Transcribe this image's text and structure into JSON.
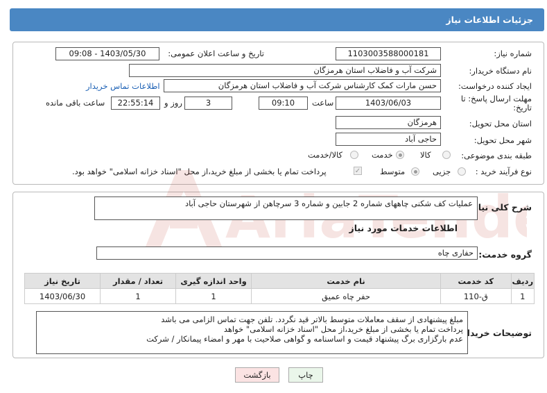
{
  "header": {
    "title": "جزئیات اطلاعات نیاز"
  },
  "form": {
    "need_number_label": "شماره نیاز:",
    "need_number": "1103003588000181",
    "announce_label": "تاریخ و ساعت اعلان عمومی:",
    "announce_value": "1403/05/30 - 09:08",
    "buyer_label": "نام دستگاه خریدار:",
    "buyer_value": "شرکت آب و فاضلاب استان هرمزگان",
    "creator_label": "ایجاد کننده درخواست:",
    "creator_value": "حسن مارات کمک کارشناس شرکت آب و فاضلاب استان هرمزگان",
    "contact_link": "اطلاعات تماس خریدار",
    "deadline_label": "مهلت ارسال پاسخ: تا تاریخ:",
    "deadline_date": "1403/06/03",
    "time_label": "ساعت",
    "deadline_time": "09:10",
    "days_value": "3",
    "days_label": "روز و",
    "remaining_time": "22:55:14",
    "remaining_label": "ساعت باقی مانده",
    "province_label": "استان محل تحویل:",
    "province_value": "هرمزگان",
    "city_label": "شهر محل تحویل:",
    "city_value": "حاجی آباد",
    "category_label": "طبقه بندی موضوعی:",
    "category_options": [
      "کالا",
      "خدمت",
      "کالا/خدمت"
    ],
    "category_selected": "خدمت",
    "process_label": "نوع فرآیند خرید :",
    "process_options": [
      "جزیی",
      "متوسط"
    ],
    "process_selected": "متوسط",
    "payment_note": "پرداخت تمام یا بخشی از مبلغ خرید،از محل \"اسناد خزانه اسلامی\" خواهد بود."
  },
  "summary": {
    "label": "شرح کلی نیاز:",
    "value": "عملیات کف شکنی چاههای شماره 2 جابین و شماره 3 سرچاهن از شهرستان حاجی آباد"
  },
  "services": {
    "section_title": "اطلاعات خدمات مورد نیاز",
    "group_label": "گروه خدمت:",
    "group_value": "حفاری چاه",
    "columns": [
      "ردیف",
      "کد خدمت",
      "نام خدمت",
      "واحد اندازه گیری",
      "تعداد / مقدار",
      "تاریخ نیاز"
    ],
    "rows": [
      [
        "1",
        "ق-110",
        "حفر چاه عمیق",
        "1",
        "1",
        "1403/06/30"
      ]
    ]
  },
  "buyer_notes": {
    "label": "توضیحات خریدار:",
    "text": "مبلغ پیشنهادی از سقف معاملات متوسط بالاتر قید نگردد. تلفن جهت تماس الزامی می باشد\nپرداخت تمام یا بخشی از مبلغ خرید،از محل \"اسناد خزانه اسلامی\" خواهد\nعدم بارگزاری برگ پیشنهاد قیمت و اساسنامه و گواهی صلاحیت با مهر و امضاء پیمانکار / شرکت"
  },
  "buttons": {
    "print": "چاپ",
    "back": "بازگشت"
  },
  "watermark": {
    "text": "AriaTender.net"
  },
  "colors": {
    "header": "#4a87c3",
    "link": "#1a5fb4",
    "back_button": "#fbe3e3",
    "print_button": "#eaf6ea"
  }
}
